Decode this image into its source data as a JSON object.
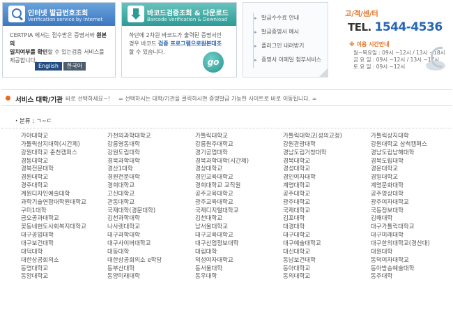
{
  "verify_card": {
    "title": "인터넷 발급번호조회",
    "subtitle": "Verification service by internet",
    "line1_a": "CERTPIA 에서는 접수받은 증명서와 ",
    "line1_b": "원본의",
    "line2_a": "일치여부를 확인",
    "line2_b": "할 수 있는검증 서비스를",
    "line3": "제공합니다.",
    "btn_english": "English",
    "btn_korean": "한국어"
  },
  "barcode_card": {
    "title": "바코드검증조회 & 다운로드",
    "subtitle": "Barcode Verification & Download",
    "line1": "하단에 2차원 바코드가 출력된 증명서인",
    "line2_a": "경우 바코드 ",
    "line2_b": "검증 프로그램으로원본대조",
    "line3": "할 수 있습니다.",
    "go_label": "go"
  },
  "quick_links": [
    "발급수수료 안내",
    "발급증명서 예시",
    "플러그인 내려받기",
    "증명서 이메일 첨부서비스"
  ],
  "customer_center": {
    "title": "고/객/센/터",
    "tel_label": "TEL.",
    "tel_number": "1544-4536",
    "hours_title": "※ 이용 시간안내",
    "hours": [
      "월~목요일 : 09시 ~12시 / 13시 ~18시",
      "금  요  일 : 09시 ~12시 / 13시 ~17시",
      "토  요  일 : 09시 ~12시"
    ]
  },
  "service_header": {
    "title": "서비스 대학/기관",
    "subtitle": "바로 선택하세요~!",
    "description": "= 선택하시는 대학/기관을 클릭하시면 증명발급 가능한 사이트로 바로 이동됩니다. ="
  },
  "category": {
    "label": "분류 :",
    "value": "ㄱ~ㄷ"
  },
  "universities": [
    "가야대학교",
    "가천의과학대학교",
    "가톨릭대학교",
    "가톨릭대학교(성의교정)",
    "가톨릭상지대학",
    "가톨릭상지대학(시간제)",
    "강릉영동대학",
    "강릉원주대학교",
    "강원관광대학",
    "강원대학교 삼척캠퍼스",
    "강원대학교 춘천캠퍼스",
    "강원도립대학",
    "경기공업대학",
    "경남도립거창대학",
    "경남도립남해대학",
    "경동대학교",
    "경북과학대학",
    "경북과학대학(시간제)",
    "경북대학교",
    "경북도립대학",
    "경북전문대학",
    "경산1대학",
    "경상대학교",
    "경성대학교",
    "경운대학교",
    "경원대학교",
    "경원전문대학",
    "경인교육대학교",
    "경인여자대학",
    "경일대학교",
    "경주대학교",
    "경희대학교",
    "경희대학교 교직원",
    "계명대학교",
    "계명문화대학",
    "계원디자인예술대학",
    "고신대학교",
    "공주교육대학교",
    "공주대학교",
    "공주영상대학",
    "과학기술연합대학원대학교",
    "관동대학교",
    "광주교육대학교",
    "광주대학교",
    "광주여자대학교",
    "구미1대학",
    "국제대학(경문대학)",
    "국제디지털대학교",
    "국제대학교",
    "국동정보대학",
    "금오공과대학교",
    "김천과학대학",
    "김천대학교",
    "김포대학",
    "김해대학",
    "꽃동네현도사회복지대학교",
    "나사렛대학교",
    "남서울대학교",
    "대경대학",
    "대구가톨릭대학교",
    "대구공업대학",
    "대구과학대학",
    "대구교육대학교",
    "대구대학교",
    "대구미래대학",
    "대구보건대학",
    "대구사이버대학교",
    "대구산업정보대학",
    "대구예술대학교",
    "대구한의대학교(경산대)",
    "대덕대학",
    "대동대학",
    "대림대학",
    "대신대학교",
    "대원대학",
    "대한상공회의소",
    "대한상공회의소 e학당",
    "덕성여자대학교",
    "동남보건대학",
    "동덕여자대학교",
    "동명대학교",
    "동부산대학",
    "동서울대학",
    "동아대학교",
    "동아방송예술대학",
    "동양대학교",
    "동양미래대학",
    "동우대학",
    "동의대학교",
    "동주대학"
  ],
  "colors": {
    "blue_header": "#3c77bf",
    "teal_header": "#2c9b94",
    "accent_orange": "#e06e1f",
    "tel_blue": "#2766b3"
  }
}
